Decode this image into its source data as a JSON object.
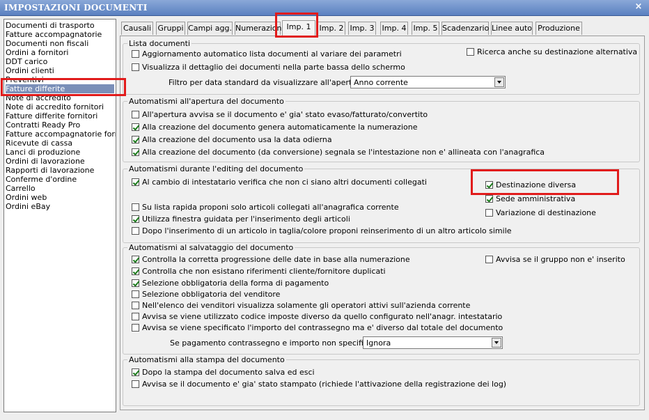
{
  "window": {
    "title": "IMPOSTAZIONI DOCUMENTI",
    "close_glyph": "×"
  },
  "doc_list": [
    "Documenti di trasporto",
    "Fatture accompagnatorie",
    "Documenti non fiscali",
    "Ordini a fornitori",
    "DDT carico",
    "Ordini clienti",
    "Preventivi",
    "Fatture differite",
    "Note di accredito",
    "Note di accredito fornitori",
    "Fatture differite fornitori",
    "Contratti Ready Pro",
    "Fatture accompagnatorie fornito",
    "Ricevute di cassa",
    "Lanci di produzione",
    "Ordini di lavorazione",
    "Rapporti di lavorazione",
    "Conferme d'ordine",
    "Carrello",
    "Ordini web",
    "Ordini eBay"
  ],
  "selected_doc": "Fatture differite",
  "tabs": [
    "Causali",
    "Gruppi",
    "Campi agg.",
    "Numerazioni",
    "Imp. 1",
    "Imp. 2",
    "Imp. 3",
    "Imp. 4",
    "Imp. 5",
    "Scadenzario",
    "Linee auto",
    "Produzione"
  ],
  "active_tab": "Imp. 1",
  "groups": {
    "lista": {
      "legend": "Lista documenti",
      "opt1": {
        "label": "Aggiornamento automatico lista documenti al variare dei parametri",
        "checked": false
      },
      "opt2": {
        "label": "Visualizza il dettaglio dei documenti nella parte bassa dello schermo",
        "checked": false
      },
      "opt3": {
        "label": "Ricerca anche su destinazione alternativa",
        "checked": false
      },
      "filter_label": "Filtro per data standard da visualizzare all'apertura :",
      "filter_value": "Anno corrente"
    },
    "apertura": {
      "legend": "Automatismi all'apertura del documento",
      "opt1": {
        "label": "All'apertura avvisa se il documento e' gia' stato evaso/fatturato/convertito",
        "checked": false
      },
      "opt2": {
        "label": "Alla creazione del documento genera automaticamente la numerazione",
        "checked": true
      },
      "opt3": {
        "label": "Alla creazione del documento usa la data odierna",
        "checked": true
      },
      "opt4": {
        "label": "Alla creazione del documento (da conversione) segnala se l'intestazione non e' allineata con l'anagrafica",
        "checked": true
      }
    },
    "editing": {
      "legend": "Automatismi durante l'editing del documento",
      "opt1": {
        "label": "Al cambio di intestatario verifica che non ci siano altri documenti collegati",
        "checked": true
      },
      "opt2": {
        "label": "Su lista rapida proponi solo articoli collegati all'anagrafica corrente",
        "checked": false
      },
      "opt3": {
        "label": "Utilizza finestra guidata per l'inserimento degli articoli",
        "checked": true
      },
      "opt4": {
        "label": "Dopo l'inserimento di un articolo in taglia/colore proponi reinserimento di un altro articolo simile",
        "checked": false
      },
      "opt5": {
        "label": "Destinazione diversa",
        "checked": true
      },
      "opt6": {
        "label": "Sede amministrativa",
        "checked": true
      },
      "opt7": {
        "label": "Variazione di destinazione",
        "checked": false
      }
    },
    "salvataggio": {
      "legend": "Automatismi al salvataggio del documento",
      "opt1": {
        "label": "Controlla la corretta progressione delle date in base alla numerazione",
        "checked": true
      },
      "opt2": {
        "label": "Controlla che non esistano riferimenti cliente/fornitore duplicati",
        "checked": true
      },
      "opt3": {
        "label": "Selezione obbligatoria della forma di pagamento",
        "checked": true
      },
      "opt4": {
        "label": "Selezione obbligatoria del venditore",
        "checked": false
      },
      "opt5": {
        "label": "Nell'elenco dei venditori visualizza solamente gli operatori attivi sull'azienda corrente",
        "checked": false
      },
      "opt6": {
        "label": "Avvisa se viene utilizzato codice imposte diverso da quello configurato nell'anagr. intestatario",
        "checked": false
      },
      "opt7": {
        "label": "Avvisa se viene specificato l'importo del contrassegno ma e' diverso dal totale del documento",
        "checked": false
      },
      "opt8": {
        "label": "Avvisa se il gruppo non e' inserito",
        "checked": false
      },
      "contrassegno_label": "Se pagamento contrassegno e importo non specificato :",
      "contrassegno_value": "Ignora"
    },
    "stampa": {
      "legend": "Automatismi alla stampa del documento",
      "opt1": {
        "label": "Dopo la stampa del documento salva ed esci",
        "checked": true
      },
      "opt2": {
        "label": "Avvisa se il documento e' gia' stato stampato (richiede l'attivazione della registrazione dei log)",
        "checked": false
      }
    }
  },
  "annotation_color": "#e11b1b"
}
